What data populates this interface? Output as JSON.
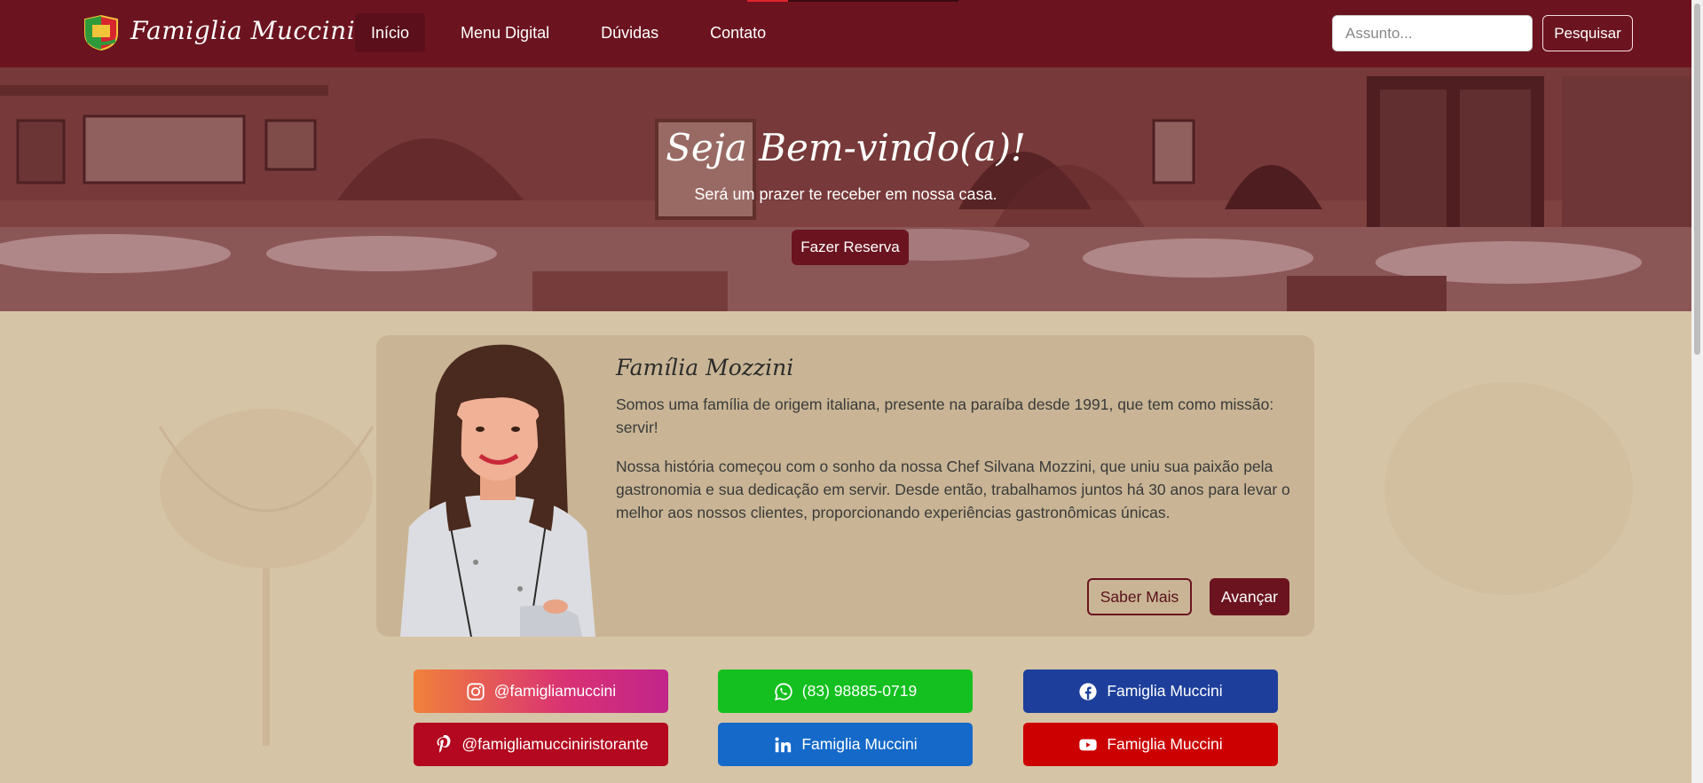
{
  "brand": {
    "name": "Famiglia Muccini"
  },
  "nav": {
    "links": [
      {
        "label": "Início",
        "active": true
      },
      {
        "label": "Menu Digital",
        "active": false
      },
      {
        "label": "Dúvidas",
        "active": false
      },
      {
        "label": "Contato",
        "active": false
      }
    ]
  },
  "search": {
    "placeholder": "Assunto...",
    "value": "",
    "button_label": "Pesquisar"
  },
  "hero": {
    "title": "Seja Bem-vindo(a)!",
    "subtitle": "Será um prazer te receber em nossa casa.",
    "button_label": "Fazer Reserva"
  },
  "about": {
    "title": "Família Mozzini",
    "paragraph1": "Somos uma família de origem italiana, presente na paraíba desde 1991, que tem como missão: servir!",
    "paragraph2": "Nossa história começou com o sonho da nossa Chef Silvana Mozzini, que uniu sua paixão pela gastronomia e sua dedicação em servir. Desde então, trabalhamos juntos há 30 anos para levar o melhor aos nossos clientes, proporcionando experiências gastronômicas únicas.",
    "more_label": "Saber Mais",
    "next_label": "Avançar"
  },
  "social": {
    "instagram": {
      "label": "@famigliamuccini",
      "icon": "instagram-icon",
      "color": "#d93174"
    },
    "whatsapp": {
      "label": "(83) 98885-0719",
      "icon": "whatsapp-icon",
      "color": "#13c01f"
    },
    "facebook": {
      "label": "Famiglia Muccini",
      "icon": "facebook-icon",
      "color": "#1d3f9b"
    },
    "pinterest": {
      "label": "@famigliamucciniristorante",
      "icon": "pinterest-icon",
      "color": "#b3081f"
    },
    "linkedin": {
      "label": "Famiglia Muccini",
      "icon": "linkedin-icon",
      "color": "#1469c9"
    },
    "youtube": {
      "label": "Famiglia Muccini",
      "icon": "youtube-icon",
      "color": "#cc0000"
    }
  },
  "colors": {
    "primary": "#6b1420",
    "background": "#d6c4a6",
    "card": "#c9b595"
  }
}
